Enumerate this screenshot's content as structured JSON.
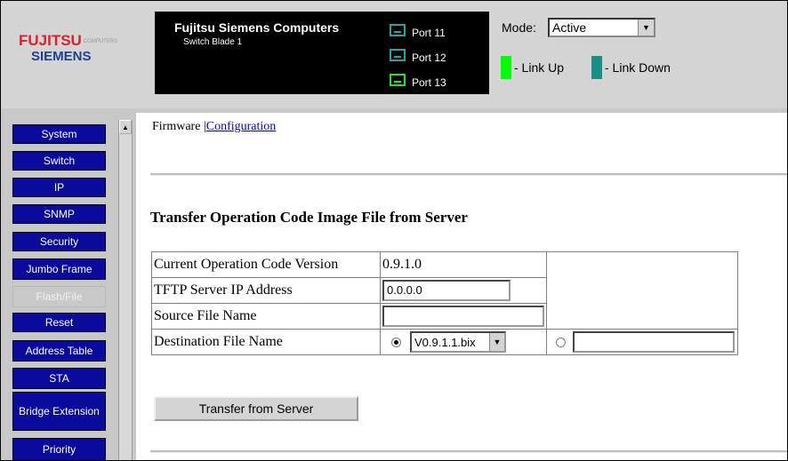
{
  "logo": {
    "line1": "FUJITSU",
    "tagline": "COMPUTERS",
    "line2": "SIEMENS"
  },
  "device": {
    "title": "Fujitsu Siemens Computers",
    "subtitle": "Switch Blade 1"
  },
  "ports": [
    {
      "label": "Port 11",
      "status": "down"
    },
    {
      "label": "Port 12",
      "status": "down"
    },
    {
      "label": "Port 13",
      "status": "up"
    }
  ],
  "mode": {
    "label": "Mode:",
    "value": "Active"
  },
  "legend": {
    "up_label": "- Link Up",
    "down_label": "- Link Down",
    "up_color": "#00ff00",
    "down_color": "#1a8f88"
  },
  "nav": [
    "System",
    "Switch",
    "IP",
    "SNMP",
    "Security",
    "Jumbo Frame",
    "Flash/File",
    "Reset",
    "Address Table",
    "STA",
    "Bridge Extension",
    "Priority"
  ],
  "nav_selected": "Flash/File",
  "breadcrumb": {
    "firmware": "Firmware",
    "separator": "|",
    "configuration": "Configuration"
  },
  "page_title": "Transfer Operation Code Image File from Server",
  "form": {
    "current_version_label": "Current Operation Code Version",
    "current_version_value": "0.9.1.0",
    "tftp_label": "TFTP Server IP Address",
    "tftp_value": "0.0.0.0",
    "source_label": "Source File Name",
    "source_value": "",
    "dest_label": "Destination File Name",
    "dest_select_value": "V0.9.1.1.bix",
    "dest_text_value": ""
  },
  "transfer_button": "Transfer from Server"
}
